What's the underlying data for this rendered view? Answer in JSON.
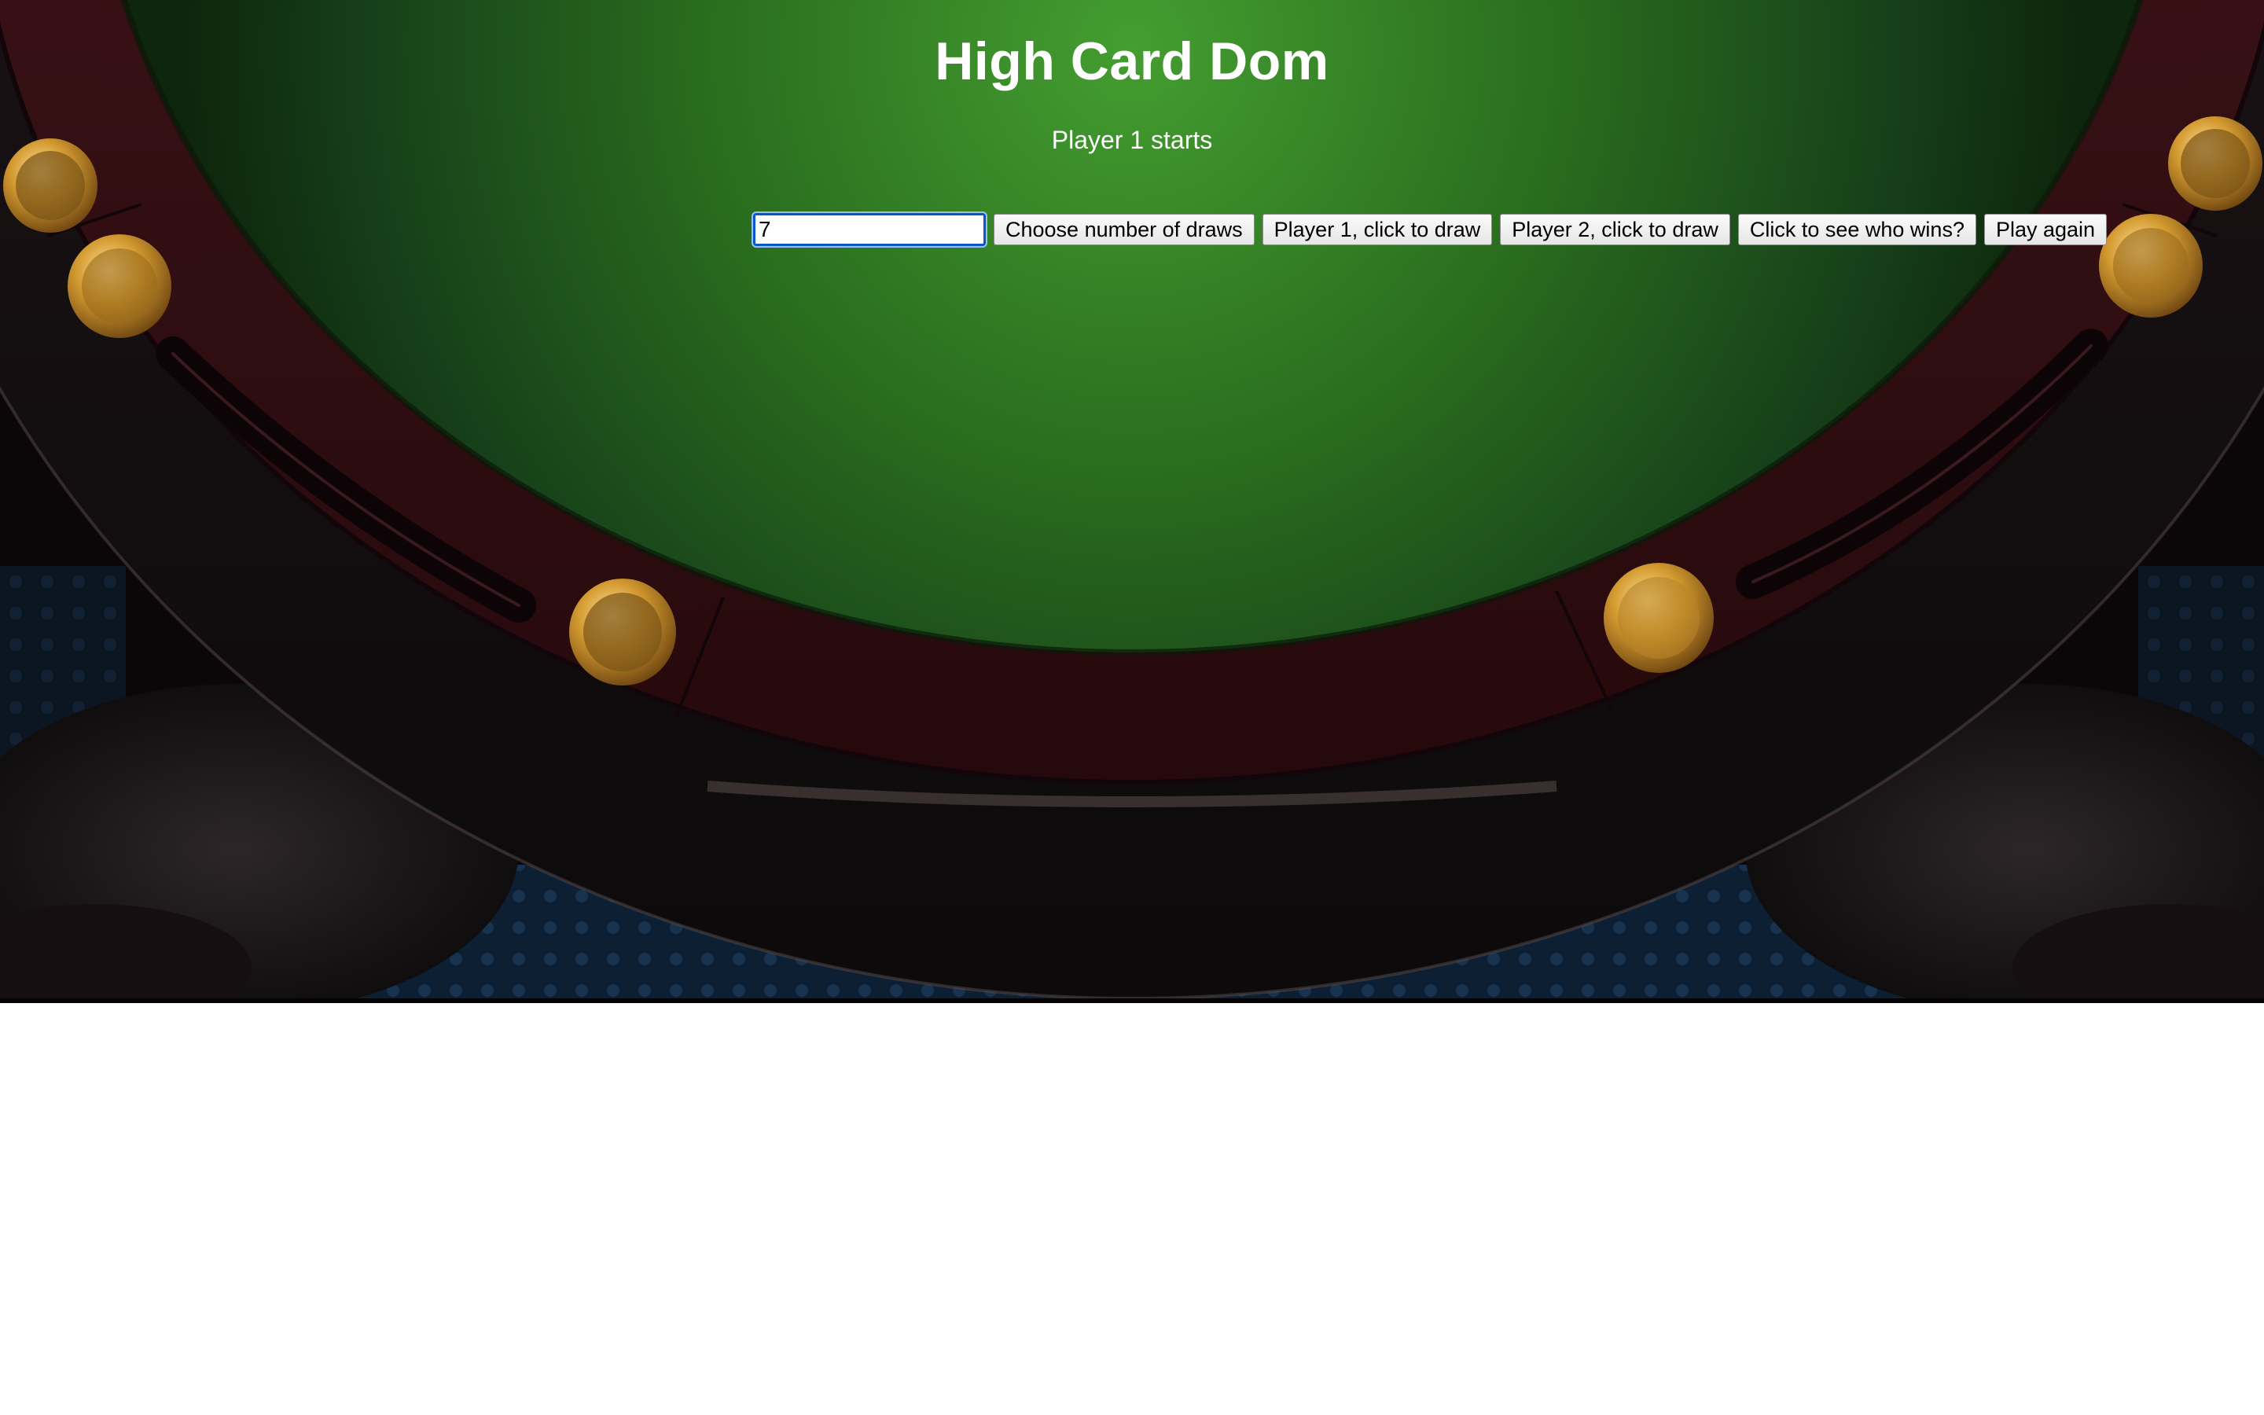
{
  "game": {
    "title": "High Card Dom",
    "status": "Player 1 starts"
  },
  "controls": {
    "draws_input_value": "7",
    "choose_draws_label": "Choose number of draws",
    "player1_draw_label": "Player 1, click to draw",
    "player2_draw_label": "Player 2, click to draw",
    "see_winner_label": "Click to see who wins?",
    "play_again_label": "Play again"
  },
  "theme": {
    "felt_light": "#3f9a2e",
    "felt_dark": "#0f2a0c",
    "rail_wood": "#3a1216",
    "leather": "#1c1416",
    "gold": "#c9922c"
  }
}
